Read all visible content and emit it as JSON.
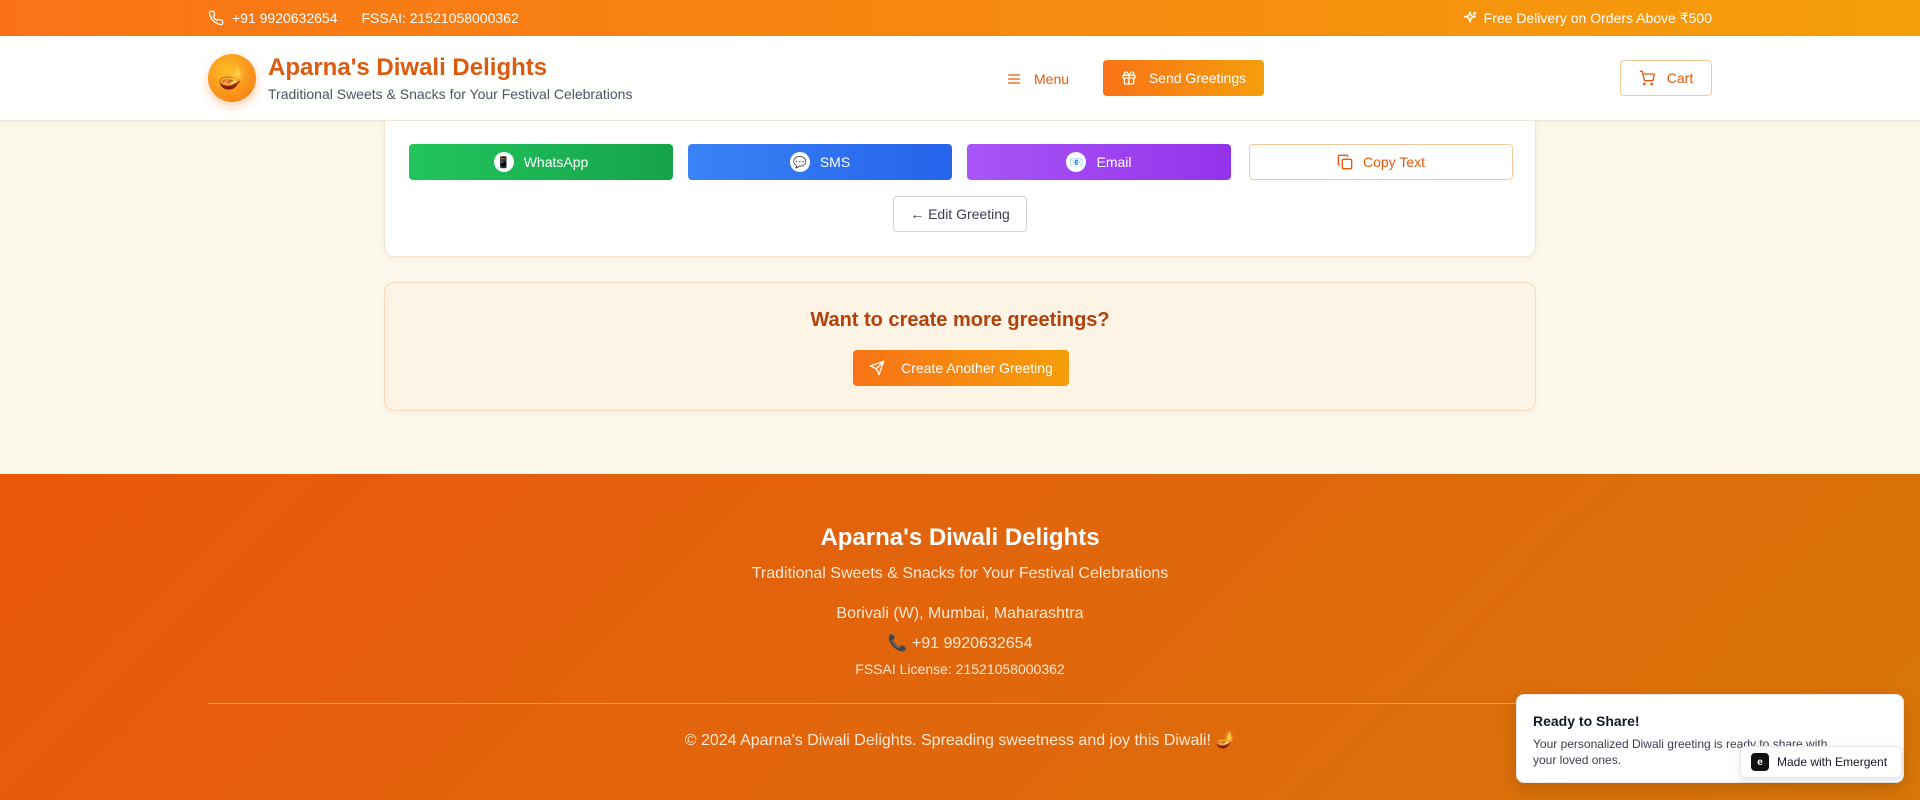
{
  "topbar": {
    "phone": "+91 9920632654",
    "fssai": "FSSAI: 21521058000362",
    "delivery": "Free Delivery on Orders Above ₹500"
  },
  "header": {
    "logo_glyph": "🪔",
    "title": "Aparna's Diwali Delights",
    "subtitle": "Traditional Sweets & Snacks for Your Festival Celebrations",
    "menu_label": "Menu",
    "send_label": "Send Greetings",
    "cart_label": "Cart"
  },
  "share": {
    "whatsapp_glyph": "📱",
    "whatsapp": "WhatsApp",
    "sms_glyph": "💬",
    "sms": "SMS",
    "email_glyph": "📧",
    "email": "Email",
    "copy": "Copy Text",
    "edit": "← Edit Greeting"
  },
  "more": {
    "title": "Want to create more greetings?",
    "create_label": "Create Another Greeting"
  },
  "footer": {
    "title": "Aparna's Diwali Delights",
    "subtitle": "Traditional Sweets & Snacks for Your Festival Celebrations",
    "address": "Borivali (W), Mumbai, Maharashtra",
    "phone": "📞 +91 9920632654",
    "fssai": "FSSAI License: 21521058000362",
    "copyright": "© 2024 Aparna's Diwali Delights. Spreading sweetness and joy this Diwali! 🪔"
  },
  "toast": {
    "title": "Ready to Share!",
    "message": "Your personalized Diwali greeting is ready to share with your loved ones."
  },
  "badge": {
    "label": "Made with Emergent"
  },
  "colors": {
    "brand_orange": "#f97316",
    "brand_amber": "#f59e0b",
    "whatsapp": "#22c55e",
    "sms": "#3b82f6",
    "email": "#a855f7"
  },
  "icons": {
    "phone": "phone-icon",
    "delivery": "sparkles-icon",
    "menu": "menu-icon",
    "send": "gift-icon",
    "cart": "cart-icon",
    "copy": "copy-icon",
    "create": "send-icon"
  }
}
